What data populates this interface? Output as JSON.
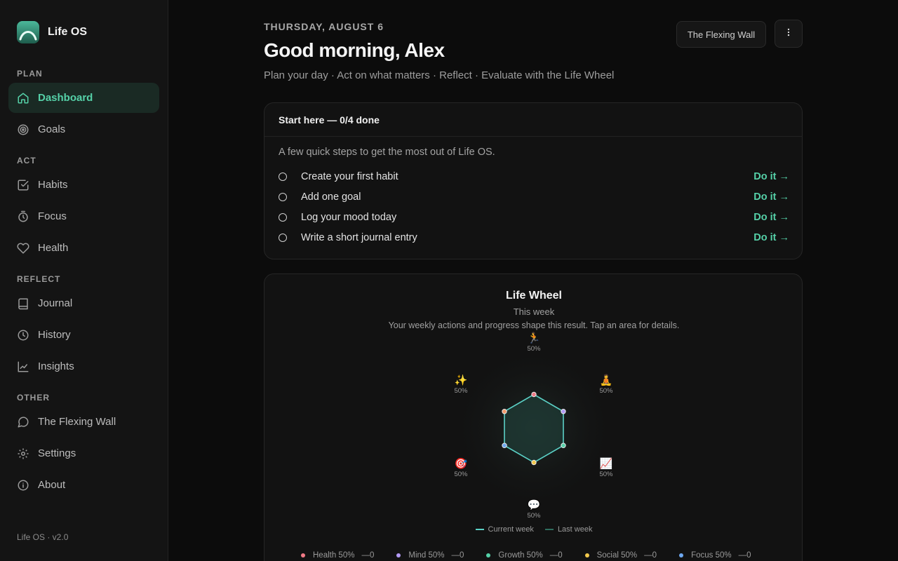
{
  "brand": {
    "name": "Life OS",
    "version": "Life OS · v2.0"
  },
  "sidebar": {
    "sections": [
      {
        "title": "PLAN",
        "items": [
          {
            "label": "Dashboard",
            "icon": "home-icon",
            "active": true
          },
          {
            "label": "Goals",
            "icon": "target-icon"
          }
        ]
      },
      {
        "title": "ACT",
        "items": [
          {
            "label": "Habits",
            "icon": "checkbox-icon"
          },
          {
            "label": "Focus",
            "icon": "timer-icon"
          },
          {
            "label": "Health",
            "icon": "heart-icon"
          }
        ]
      },
      {
        "title": "REFLECT",
        "items": [
          {
            "label": "Journal",
            "icon": "book-icon"
          },
          {
            "label": "History",
            "icon": "clock-icon"
          },
          {
            "label": "Insights",
            "icon": "chart-icon"
          }
        ]
      },
      {
        "title": "OTHER",
        "items": [
          {
            "label": "The Flexing Wall",
            "icon": "chat-icon"
          },
          {
            "label": "Settings",
            "icon": "gear-icon"
          },
          {
            "label": "About",
            "icon": "info-icon"
          }
        ]
      }
    ]
  },
  "header": {
    "date": "THURSDAY, AUGUST 6",
    "greeting": "Good morning, Alex",
    "subtitle": "Plan your day · Act on what matters · Reflect · Evaluate with the Life Wheel",
    "wall_button": "The Flexing Wall",
    "more_icon": "kebab-menu-icon"
  },
  "start": {
    "title": "Start here — 0/4 done",
    "intro": "A few quick steps to get the most out of Life OS.",
    "tasks": [
      {
        "label": "Create your first habit",
        "action": "Do it →"
      },
      {
        "label": "Add one goal",
        "action": "Do it →"
      },
      {
        "label": "Log your mood today",
        "action": "Do it →"
      },
      {
        "label": "Write a short journal entry",
        "action": "Do it →"
      }
    ]
  },
  "wheel": {
    "title": "Life Wheel",
    "period": "This week",
    "description": "Your weekly actions and progress shape this result. Tap an area for details.",
    "axes": [
      {
        "emoji": "🏃",
        "pct": "50%",
        "color": "#f07a86"
      },
      {
        "emoji": "🧘",
        "pct": "50%",
        "color": "#b39af5"
      },
      {
        "emoji": "📈",
        "pct": "50%",
        "color": "#55d1a8"
      },
      {
        "emoji": "💬",
        "pct": "50%",
        "color": "#f2c94c"
      },
      {
        "emoji": "🎯",
        "pct": "50%",
        "color": "#6ea8f0"
      },
      {
        "emoji": "✨",
        "pct": "50%",
        "color": "#f59a6b"
      }
    ],
    "values": [
      0.5,
      0.5,
      0.5,
      0.5,
      0.5,
      0.5
    ],
    "legend": [
      {
        "label": "Current week",
        "color": "#5bd1c6"
      },
      {
        "label": "Last week",
        "color": "#2f6e5f"
      }
    ],
    "scores": [
      {
        "label": "Health 50%",
        "delta": "—0",
        "color": "#f07a86"
      },
      {
        "label": "Mind 50%",
        "delta": "—0",
        "color": "#b39af5"
      },
      {
        "label": "Growth 50%",
        "delta": "—0",
        "color": "#55d1a8"
      },
      {
        "label": "Social 50%",
        "delta": "—0",
        "color": "#f2c94c"
      },
      {
        "label": "Focus 50%",
        "delta": "—0",
        "color": "#6ea8f0"
      }
    ],
    "colors": {
      "accent": "#55d1a8",
      "line": "#5bd1c6"
    }
  }
}
